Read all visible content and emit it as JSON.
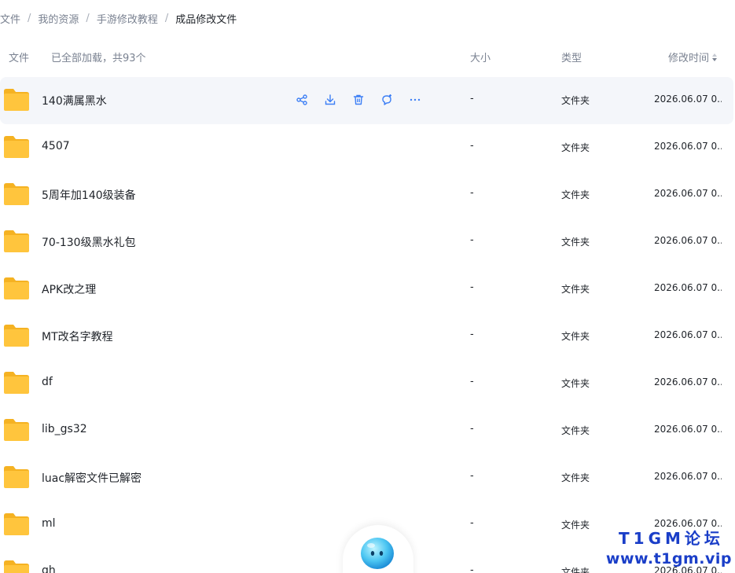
{
  "breadcrumb": {
    "items": [
      "部文件",
      "我的资源",
      "手游修改教程",
      "成品修改文件"
    ],
    "separator": "/"
  },
  "list_header": {
    "name": "文件",
    "loaded_status": "已全部加载，共93个",
    "size": "大小",
    "type": "类型",
    "mtime": "修改时间"
  },
  "row_actions": {
    "icons": [
      "share-icon",
      "download-icon",
      "delete-icon",
      "comment-icon",
      "more-icon"
    ],
    "accent_color": "#3d7ff5"
  },
  "files": [
    {
      "name": "140满属黑水",
      "size": "-",
      "type": "文件夹",
      "mtime": "2026.06.07 0..."
    },
    {
      "name": "4507",
      "size": "-",
      "type": "文件夹",
      "mtime": "2026.06.07 0..."
    },
    {
      "name": "5周年加140级装备",
      "size": "-",
      "type": "文件夹",
      "mtime": "2026.06.07 0..."
    },
    {
      "name": "70-130级黑水礼包",
      "size": "-",
      "type": "文件夹",
      "mtime": "2026.06.07 0..."
    },
    {
      "name": "APK改之理",
      "size": "-",
      "type": "文件夹",
      "mtime": "2026.06.07 0..."
    },
    {
      "name": "MT改名字教程",
      "size": "-",
      "type": "文件夹",
      "mtime": "2026.06.07 0..."
    },
    {
      "name": "df",
      "size": "-",
      "type": "文件夹",
      "mtime": "2026.06.07 0..."
    },
    {
      "name": "lib_gs32",
      "size": "-",
      "type": "文件夹",
      "mtime": "2026.06.07 0..."
    },
    {
      "name": "luac解密文件已解密",
      "size": "-",
      "type": "文件夹",
      "mtime": "2026.06.07 0..."
    },
    {
      "name": "ml",
      "size": "-",
      "type": "文件夹",
      "mtime": "2026.06.07 0..."
    },
    {
      "name": "qh",
      "size": "-",
      "type": "文件夹",
      "mtime": "2026.06.07 0..."
    }
  ],
  "watermark": {
    "line1": "T1GM论坛",
    "line2": "www.t1gm.vip"
  },
  "colors": {
    "folder": "#ffc53d",
    "folder_back": "#f5b222",
    "hover_row": "#f4f6fa",
    "watermark": "#1a3ec8"
  }
}
